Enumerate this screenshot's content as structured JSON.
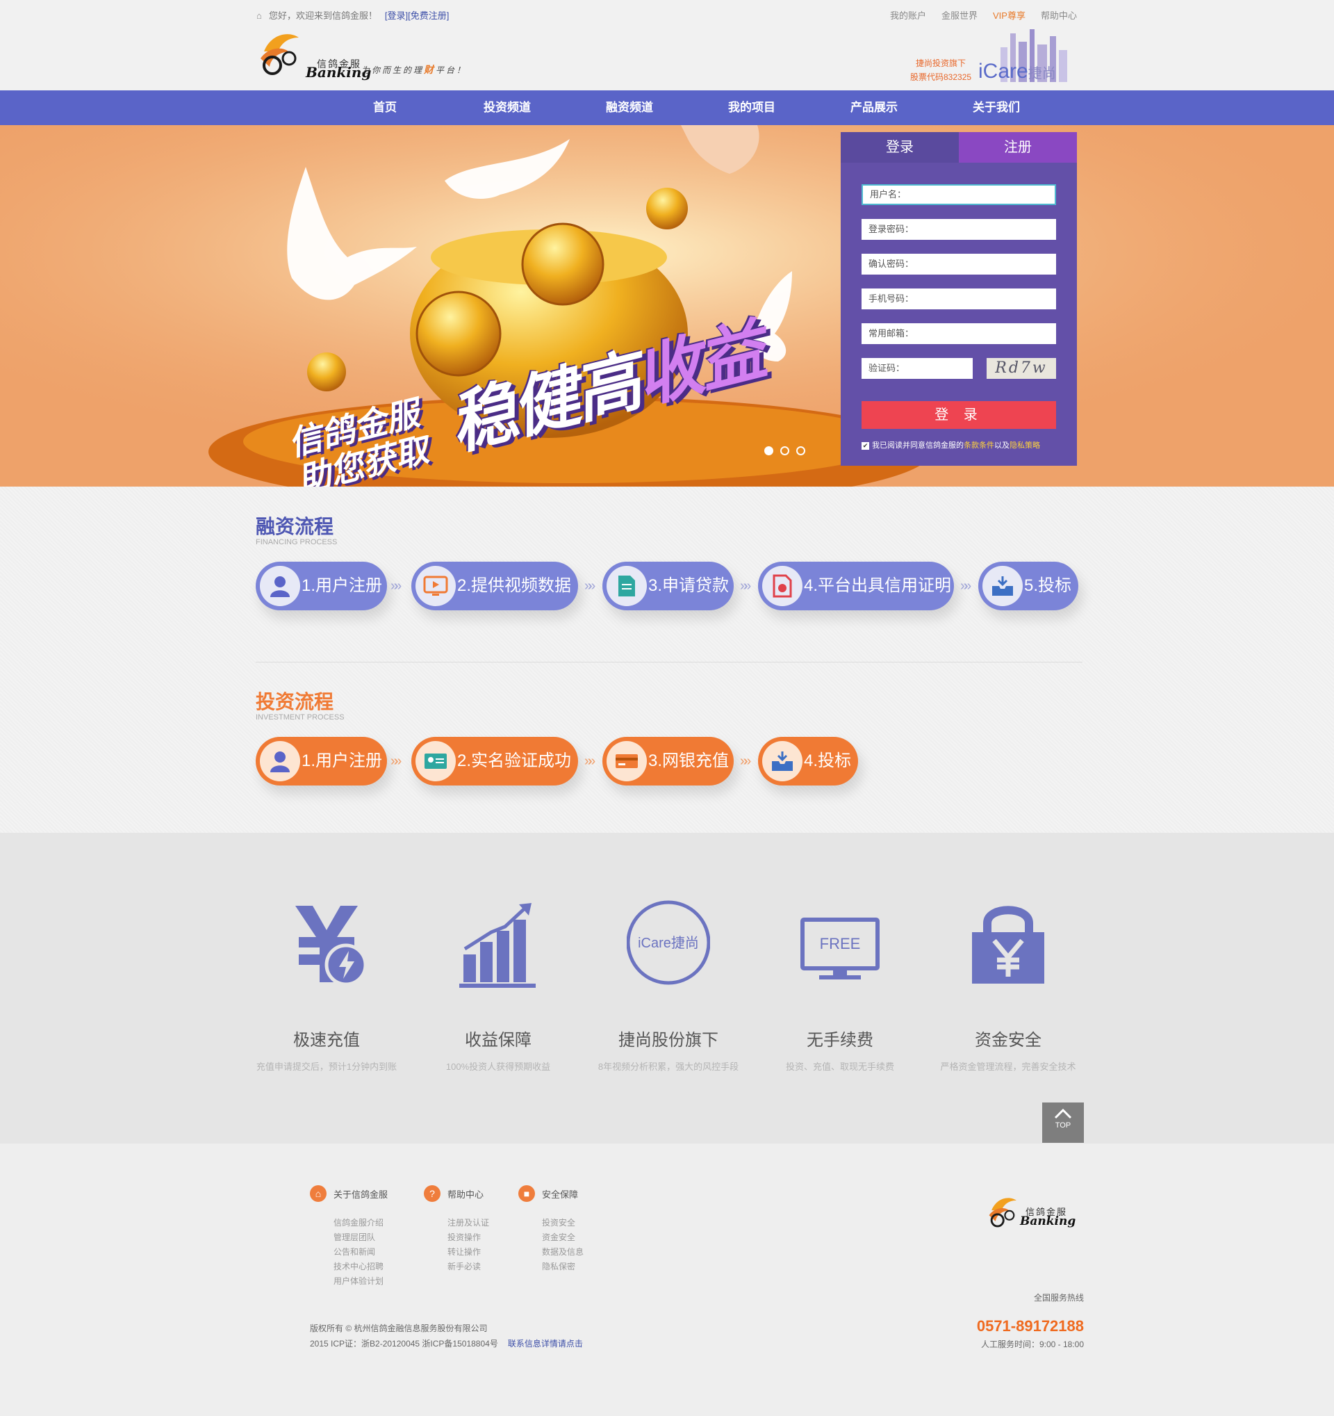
{
  "header": {
    "greeting": "您好，欢迎来到信鸽金服！",
    "login_link": "[登录]",
    "register_link": "[免费注册]",
    "top_links": [
      "我的账户",
      "金服世界",
      "VIP尊享",
      "帮助中心"
    ],
    "logo_cn": "信鸽金服",
    "logo_en": "Banking",
    "slogan_pre": "为你而生的理",
    "slogan_em": "财",
    "slogan_post": "平台！",
    "brand_sub1": "捷尚投资旗下",
    "brand_sub2": "股票代码832325",
    "brand_icare": "iCare",
    "brand_icare_cn": "捷尚"
  },
  "nav": [
    "首页",
    "投资频道",
    "融资频道",
    "我的项目",
    "产品展示",
    "关于我们"
  ],
  "banner": {
    "headline_a": "稳健高",
    "headline_b": "收益",
    "tagline_1": "信鸽金服",
    "tagline_2": "助您获取"
  },
  "login": {
    "tab_login": "登录",
    "tab_register": "注册",
    "fields": [
      "用户名：",
      "登录密码：",
      "确认密码：",
      "手机号码：",
      "常用邮箱："
    ],
    "captcha_label": "验证码：",
    "captcha_text": "Rd7w",
    "submit": "登 录",
    "agree_pre": "我已阅读并同意信鸽金服的",
    "agree_terms": "条款条件",
    "agree_mid": "以及",
    "agree_privacy": "隐私策略"
  },
  "financing": {
    "title": "融资流程",
    "subtitle": "FINANCING PROCESS",
    "steps": [
      "1.用户注册",
      "2.提供视频数据",
      "3.申请贷款",
      "4.平台出具信用证明",
      "5.投标"
    ]
  },
  "investment": {
    "title": "投资流程",
    "subtitle": "INVESTMENT PROCESS",
    "steps": [
      "1.用户注册",
      "2.实名验证成功",
      "3.网银充值",
      "4.投标"
    ]
  },
  "features": [
    {
      "name": "极速充值",
      "desc": "充值申请提交后，预计1分钟内到账",
      "icon": "yen-lightning-icon"
    },
    {
      "name": "收益保障",
      "desc": "100%投资人获得预期收益",
      "icon": "growth-chart-icon"
    },
    {
      "name": "捷尚股份旗下",
      "desc": "8年视频分析积累，强大的风控手段",
      "icon": "icare-badge-icon",
      "badge": "iCare捷尚"
    },
    {
      "name": "无手续费",
      "desc": "投资、充值、取现无手续费",
      "icon": "free-monitor-icon",
      "badge": "FREE"
    },
    {
      "name": "资金安全",
      "desc": "严格资金管理流程，完善安全技术",
      "icon": "lock-yen-icon"
    }
  ],
  "top_button": "TOP",
  "footer": {
    "columns": [
      {
        "title": "关于信鸽金服",
        "items": [
          "信鸽金服介绍",
          "管理层团队",
          "公告和新闻",
          "技术中心招聘",
          "用户体验计划"
        ]
      },
      {
        "title": "帮助中心",
        "items": [
          "注册及认证",
          "投资操作",
          "转让操作",
          "新手必读"
        ]
      },
      {
        "title": "安全保障",
        "items": [
          "投资安全",
          "资金安全",
          "数据及信息",
          "隐私保密"
        ]
      }
    ],
    "copyright": "版权所有 © 杭州信鸽金融信息服务股份有限公司",
    "icp": "2015  ICP证：浙B2-20120045    浙ICP备15018804号",
    "contact_link": "联系信息详情请点击",
    "hotline_label": "全国服务热线",
    "hotline": "0571-89172188",
    "hours": "人工服务时间：9:00 - 18:00",
    "logo_cn": "信鸽金服",
    "logo_en": "Banking"
  },
  "colors": {
    "nav": "#5a64c8",
    "accent_orange": "#f07a34",
    "purple_step": "#7b84d8",
    "login_panel": "#6350a8",
    "login_button": "#ee4451"
  }
}
